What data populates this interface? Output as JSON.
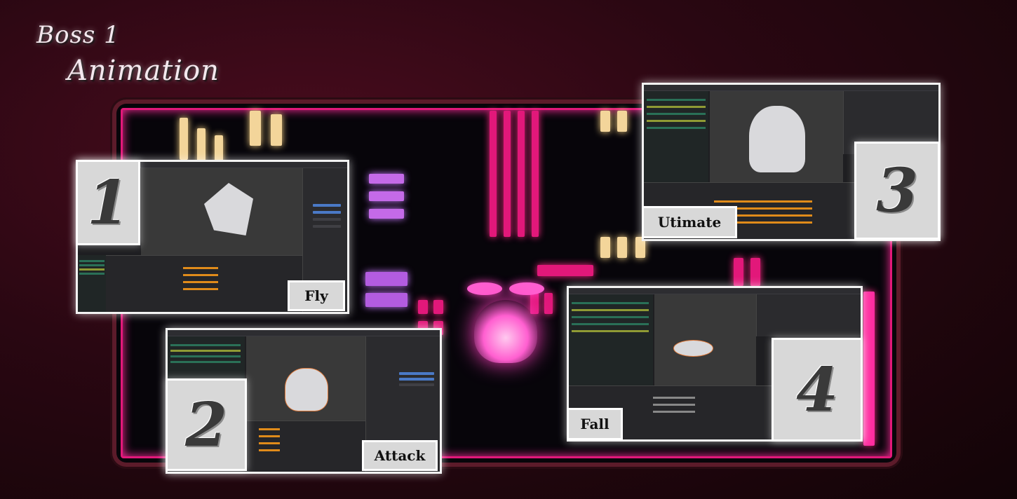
{
  "heading": {
    "line1": "Boss 1",
    "line2": "Animation"
  },
  "colors": {
    "neon_pink": "#e2187a",
    "neon_yellow": "#f3d59a",
    "neon_violet": "#b35ce0",
    "panel_border": "#ffffff"
  },
  "panels": [
    {
      "number": "1",
      "label": "Fly"
    },
    {
      "number": "2",
      "label": "Attack"
    },
    {
      "number": "3",
      "label": "Utimate"
    },
    {
      "number": "4",
      "label": "Fall"
    }
  ]
}
